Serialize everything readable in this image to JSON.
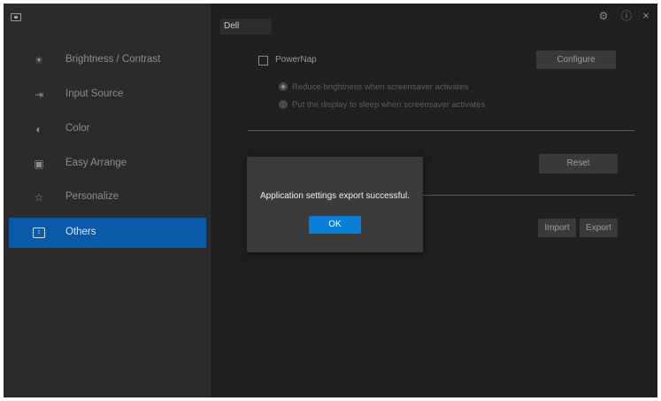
{
  "window": {
    "titlebar": {
      "app_icon": "monitor-icon",
      "settings_icon": "gear-icon",
      "help_icon": "help-icon",
      "close_icon": "close-icon",
      "close_glyph": "×"
    },
    "monitor_tab": "Dell"
  },
  "sidebar": {
    "items": [
      {
        "label": "Brightness / Contrast",
        "icon": "sun-icon",
        "glyph": "☀"
      },
      {
        "label": "Input Source",
        "icon": "input-source-icon",
        "glyph": "⇥"
      },
      {
        "label": "Color",
        "icon": "palette-icon",
        "glyph": "◐"
      },
      {
        "label": "Easy Arrange",
        "icon": "layout-icon",
        "glyph": "▣"
      },
      {
        "label": "Personalize",
        "icon": "star-icon",
        "glyph": "☆"
      },
      {
        "label": "Others",
        "icon": "others-icon",
        "glyph": "↕",
        "active": true
      }
    ]
  },
  "main": {
    "powernap": {
      "checkbox_label": "PowerNap",
      "checked": false,
      "configure_button": "Configure",
      "options": [
        {
          "label": "Reduce brightness when screensaver activates",
          "selected": true
        },
        {
          "label": "Put the display to sleep when screensaver activates",
          "selected": false
        }
      ]
    },
    "reset_button": "Reset",
    "import_button": "Import",
    "export_button": "Export"
  },
  "dialog": {
    "message": "Application settings export successful.",
    "ok_button": "OK"
  },
  "colors": {
    "accent": "#0b5aa9",
    "ok_button": "#0a7fd9",
    "background": "#1f1f1f"
  }
}
